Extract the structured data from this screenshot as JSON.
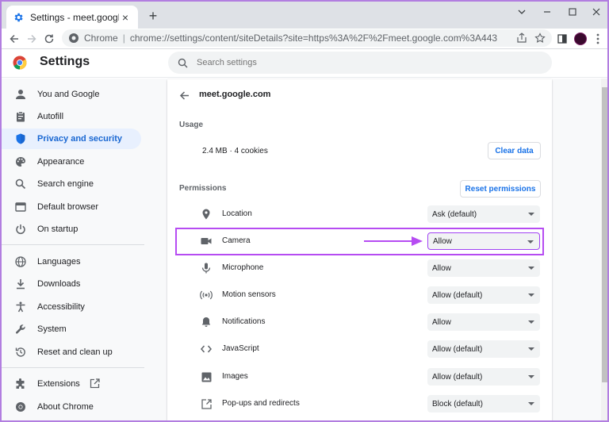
{
  "tab": {
    "title": "Settings - meet.google.com",
    "close": "×"
  },
  "toolbar": {
    "site_label": "Chrome",
    "separator": "|",
    "url": "chrome://settings/content/siteDetails?site=https%3A%2F%2Fmeet.google.com%3A443"
  },
  "header": {
    "title": "Settings",
    "search_placeholder": "Search settings"
  },
  "sidebar": {
    "items": [
      {
        "label": "You and Google",
        "icon": "person-icon"
      },
      {
        "label": "Autofill",
        "icon": "clipboard-icon"
      },
      {
        "label": "Privacy and security",
        "icon": "shield-icon",
        "active": true
      },
      {
        "label": "Appearance",
        "icon": "palette-icon"
      },
      {
        "label": "Search engine",
        "icon": "search-icon"
      },
      {
        "label": "Default browser",
        "icon": "browser-icon"
      },
      {
        "label": "On startup",
        "icon": "power-icon"
      },
      {
        "label": "Languages",
        "icon": "globe-icon"
      },
      {
        "label": "Downloads",
        "icon": "download-icon"
      },
      {
        "label": "Accessibility",
        "icon": "accessibility-icon"
      },
      {
        "label": "System",
        "icon": "wrench-icon"
      },
      {
        "label": "Reset and clean up",
        "icon": "history-icon"
      },
      {
        "label": "Extensions",
        "icon": "puzzle-icon"
      },
      {
        "label": "About Chrome",
        "icon": "chrome-icon"
      }
    ]
  },
  "site": {
    "title": "meet.google.com",
    "usage_label": "Usage",
    "usage_value": "2.4 MB · 4 cookies",
    "clear_data": "Clear data",
    "permissions_label": "Permissions",
    "reset_permissions": "Reset permissions"
  },
  "permissions": [
    {
      "label": "Location",
      "value": "Ask (default)",
      "icon": "location-pin-icon"
    },
    {
      "label": "Camera",
      "value": "Allow",
      "icon": "camera-icon",
      "highlighted": true
    },
    {
      "label": "Microphone",
      "value": "Allow",
      "icon": "microphone-icon"
    },
    {
      "label": "Motion sensors",
      "value": "Allow (default)",
      "icon": "sensors-icon"
    },
    {
      "label": "Notifications",
      "value": "Allow",
      "icon": "bell-icon"
    },
    {
      "label": "JavaScript",
      "value": "Allow (default)",
      "icon": "code-icon"
    },
    {
      "label": "Images",
      "value": "Allow (default)",
      "icon": "image-icon"
    },
    {
      "label": "Pop-ups and redirects",
      "value": "Block (default)",
      "icon": "popup-icon"
    }
  ],
  "colors": {
    "accent": "#1a73e8",
    "highlight": "#b64cf2",
    "active_bg": "#e8f0fe"
  }
}
